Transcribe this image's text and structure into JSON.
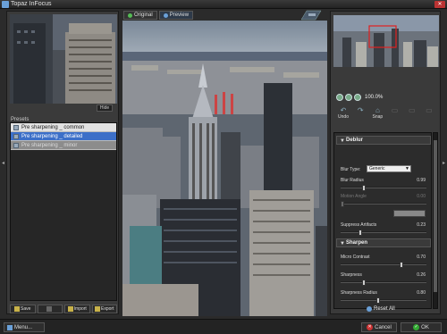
{
  "window": {
    "title": "Topaz InFocus",
    "close_glyph": "✕"
  },
  "left": {
    "hide_label": "Hide",
    "presets_label": "Presets",
    "presets": [
      {
        "label": "Pre sharpening _ common",
        "state": "normal"
      },
      {
        "label": "Pre sharpening _ detailed",
        "state": "selected"
      },
      {
        "label": "Pre sharpening _ minor",
        "state": "dim"
      }
    ],
    "buttons": [
      {
        "label": "Save",
        "enabled": true
      },
      {
        "label": "",
        "enabled": false
      },
      {
        "label": "Import",
        "enabled": true
      },
      {
        "label": "Export",
        "enabled": true
      }
    ]
  },
  "side_arrows": {
    "left": "◂",
    "right": "▸"
  },
  "tabs": [
    {
      "label": "Original",
      "icon": "green-dot-icon"
    },
    {
      "label": "Preview",
      "icon": "blue-dot-icon"
    }
  ],
  "right": {
    "zoom_text": "100.0%",
    "tools": [
      {
        "label": "Undo",
        "icon": "undo-icon",
        "glyph": "↶",
        "enabled": true
      },
      {
        "label": "",
        "icon": "redo-icon",
        "glyph": "↷",
        "enabled": true
      },
      {
        "label": "Snap",
        "icon": "snap-icon",
        "glyph": "⌂",
        "enabled": true
      },
      {
        "label": "",
        "icon": "tool-icon",
        "glyph": "▭",
        "enabled": false
      },
      {
        "label": "",
        "icon": "tool-icon",
        "glyph": "▭",
        "enabled": false
      },
      {
        "label": "",
        "icon": "tool-icon",
        "glyph": "▭",
        "enabled": false
      }
    ],
    "deblur": {
      "header": "Deblur",
      "blur_type_label": "Blur Type:",
      "blur_type_value": "Generic",
      "blur_radius_label": "Blur Radius",
      "blur_radius_value": "0.99",
      "motion_angle_label": "Motion Angle",
      "motion_angle_value": "0.00",
      "suppress_label": "Suppress Artifacts",
      "suppress_value": "0.23"
    },
    "sharpen": {
      "header": "Sharpen",
      "micro_label": "Micro Contrast",
      "micro_value": "0.70",
      "sharpness_label": "Sharpness",
      "sharpness_value": "0.26",
      "radius_label": "Sharpness Radius",
      "radius_value": "0.80"
    },
    "reset_label": "Reset All"
  },
  "bottom": {
    "menu_label": "Menu...",
    "cancel_label": "Cancel",
    "ok_label": "OK",
    "cancel_glyph": "✕",
    "ok_glyph": "✓"
  },
  "colors": {
    "selected_preset": "#3c6fc8",
    "accent_blue": "#6aa0d8",
    "ok_green": "#33aa33",
    "cancel_red": "#cc3333",
    "nav_rect": "#e02020"
  }
}
